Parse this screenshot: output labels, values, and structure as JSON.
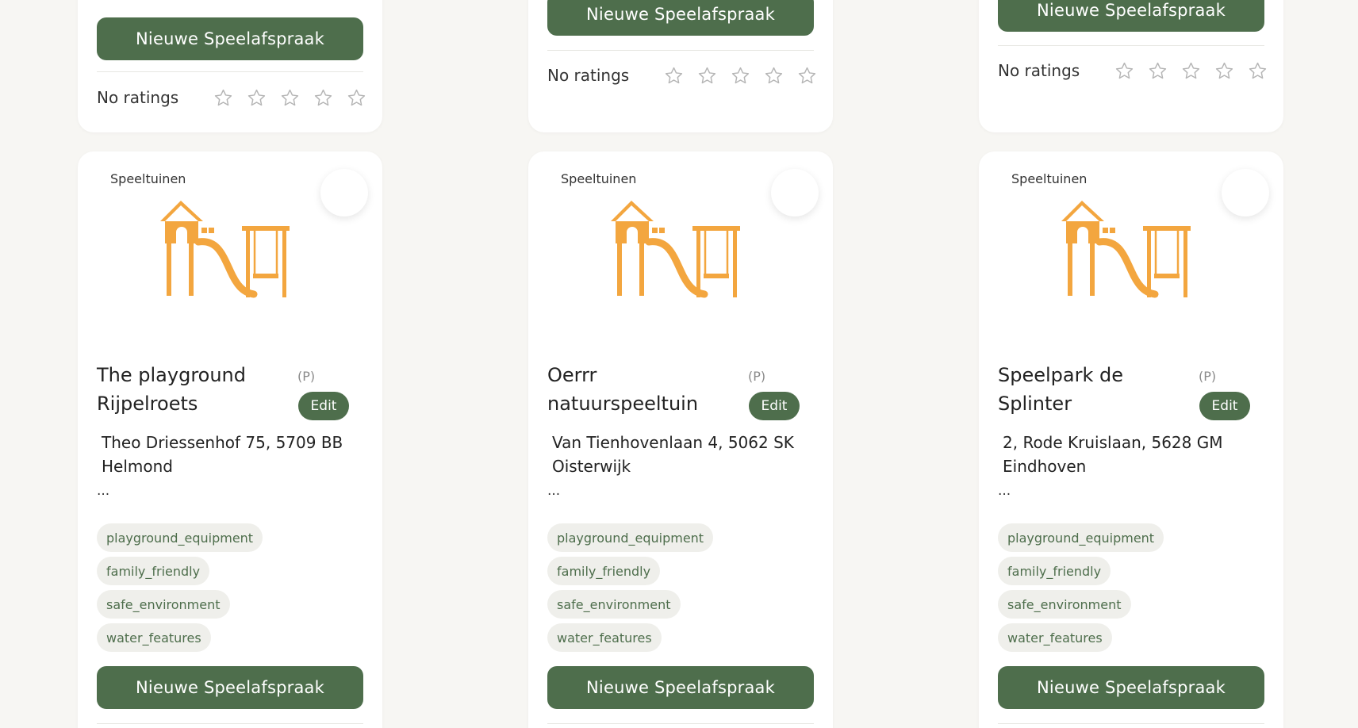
{
  "top_cards": [
    {
      "button_label": "Nieuwe Speelafspraak",
      "rating_label": "No ratings"
    },
    {
      "button_label": "Nieuwe Speelafspraak",
      "rating_label": "No ratings"
    },
    {
      "button_label": "Nieuwe Speelafspraak",
      "rating_label": "No ratings"
    }
  ],
  "cards": [
    {
      "category": "Speeltuinen",
      "title": "The playground Rijpelroets",
      "private_tag": "(P)",
      "edit_label": "Edit",
      "address": "Theo Driessenhof 75, 5709 BB Helmond",
      "description": "...",
      "tags": [
        "playground_equipment",
        "family_friendly",
        "safe_environment",
        "water_features"
      ],
      "button_label": "Nieuwe Speelafspraak"
    },
    {
      "category": "Speeltuinen",
      "title": "Oerrr natuurspeeltuin",
      "private_tag": "(P)",
      "edit_label": "Edit",
      "address": "Van Tienhovenlaan 4, 5062 SK Oisterwijk",
      "description": "...",
      "tags": [
        "playground_equipment",
        "family_friendly",
        "safe_environment",
        "water_features"
      ],
      "button_label": "Nieuwe Speelafspraak"
    },
    {
      "category": "Speeltuinen",
      "title": "Speelpark de Splinter",
      "private_tag": "(P)",
      "edit_label": "Edit",
      "address": "2, Rode Kruislaan, 5628 GM Eindhoven",
      "description": "...",
      "tags": [
        "playground_equipment",
        "family_friendly",
        "safe_environment",
        "water_features"
      ],
      "button_label": "Nieuwe Speelafspraak"
    }
  ],
  "icons": {
    "playground": "playground-icon",
    "star": "star-outline-icon"
  },
  "colors": {
    "primary": "#4e6e4c",
    "accent": "#f3a63f",
    "background": "#f7f6f3",
    "tag_bg": "#efefeb",
    "star": "#b5b5b5"
  }
}
